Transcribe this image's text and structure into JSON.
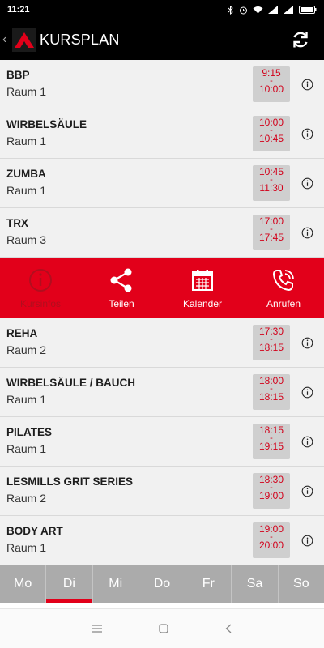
{
  "status_bar": {
    "time": "11:21",
    "battery": "97"
  },
  "app_bar": {
    "back": "‹",
    "title": "KURSPLAN"
  },
  "courses_top": [
    {
      "title": "BBP",
      "room": "Raum 1",
      "start": "9:15",
      "end": "10:00"
    },
    {
      "title": "WIRBELSÄULE",
      "room": "Raum 1",
      "start": "10:00",
      "end": "10:45"
    },
    {
      "title": "ZUMBA",
      "room": "Raum 1",
      "start": "10:45",
      "end": "11:30"
    },
    {
      "title": "TRX",
      "room": "Raum 3",
      "start": "17:00",
      "end": "17:45"
    }
  ],
  "actions": [
    {
      "label": "Kursinfos",
      "icon": "info-icon"
    },
    {
      "label": "Teilen",
      "icon": "share-icon"
    },
    {
      "label": "Kalender",
      "icon": "calendar-icon"
    },
    {
      "label": "Anrufen",
      "icon": "phone-icon"
    }
  ],
  "courses_bottom": [
    {
      "title": "REHA",
      "room": "Raum 2",
      "start": "17:30",
      "end": "18:15"
    },
    {
      "title": "WIRBELSÄULE / BAUCH",
      "room": "Raum 1",
      "start": "18:00",
      "end": "18:15"
    },
    {
      "title": "PILATES",
      "room": "Raum 1",
      "start": "18:15",
      "end": "19:15"
    },
    {
      "title": "LESMILLS GRIT SERIES",
      "room": "Raum 2",
      "start": "18:30",
      "end": "19:00"
    },
    {
      "title": "BODY ART",
      "room": "Raum 1",
      "start": "19:00",
      "end": "20:00"
    }
  ],
  "time_separator": "-",
  "day_tabs": [
    "Mo",
    "Di",
    "Mi",
    "Do",
    "Fr",
    "Sa",
    "So"
  ],
  "active_day": "Di",
  "colors": {
    "accent": "#e2001a",
    "time_text": "#d2001a",
    "tab_bg": "#ababab"
  }
}
